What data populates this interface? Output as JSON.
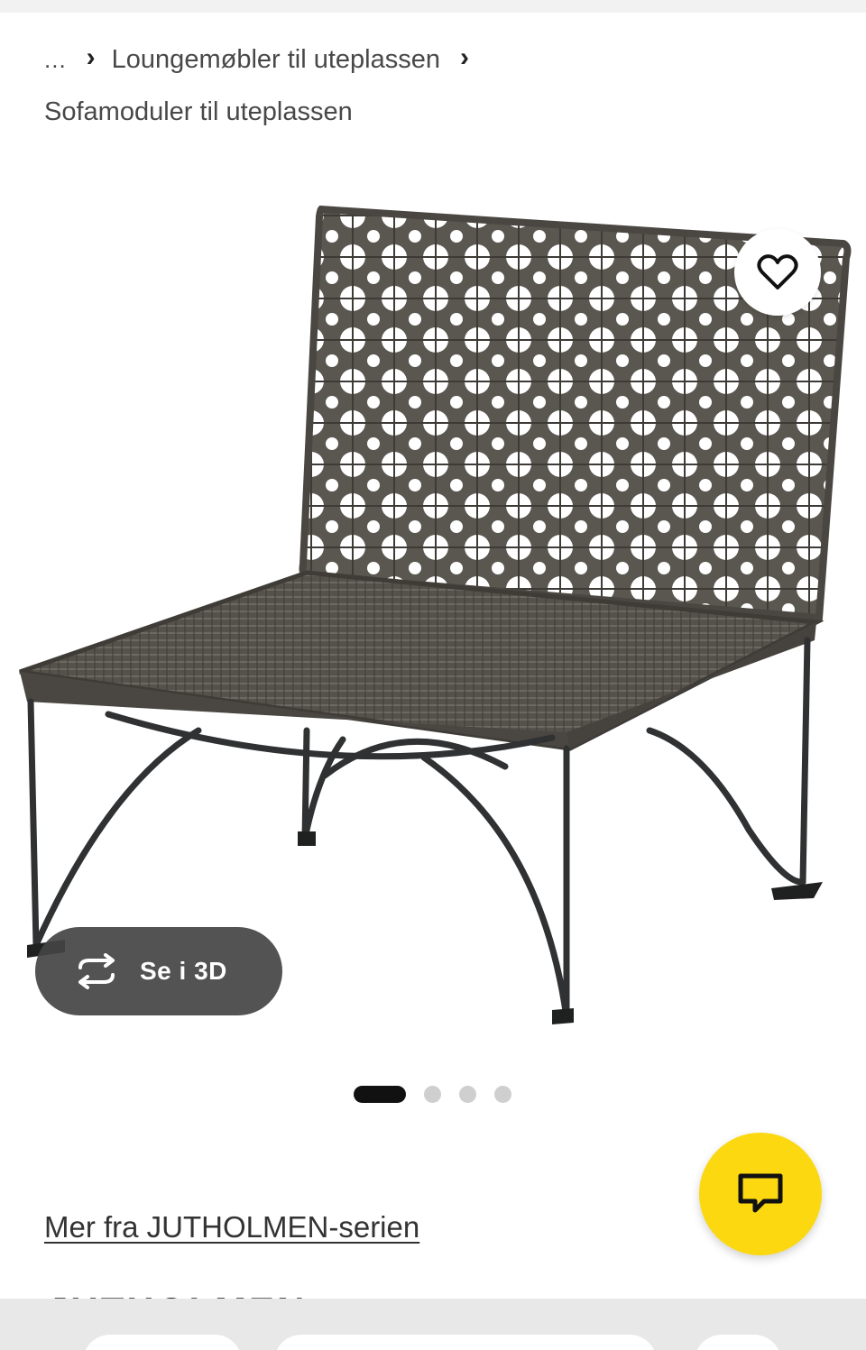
{
  "breadcrumb": {
    "ellipsis": "...",
    "separator": "›",
    "parent": "Loungemøbler til uteplassen",
    "current": "Sofamoduler til uteplassen"
  },
  "product": {
    "image_icon": "product-photo-chair"
  },
  "actions": {
    "favorite_icon": "heart-outline-icon",
    "view_3d_label": "Se i 3D",
    "view_3d_icon": "rotate-3d-icon",
    "chat_icon": "chat-bubble-icon"
  },
  "carousel": {
    "total": 4,
    "active_index": 0
  },
  "series": {
    "link_text": "Mer fra JUTHOLMEN-serien",
    "heading": "JUTHOLMEN"
  },
  "colors": {
    "chat_fab": "#fcd810",
    "view_3d_bg": "#444444",
    "active_dot": "#111111",
    "inactive_dot": "#cfcfcf"
  }
}
